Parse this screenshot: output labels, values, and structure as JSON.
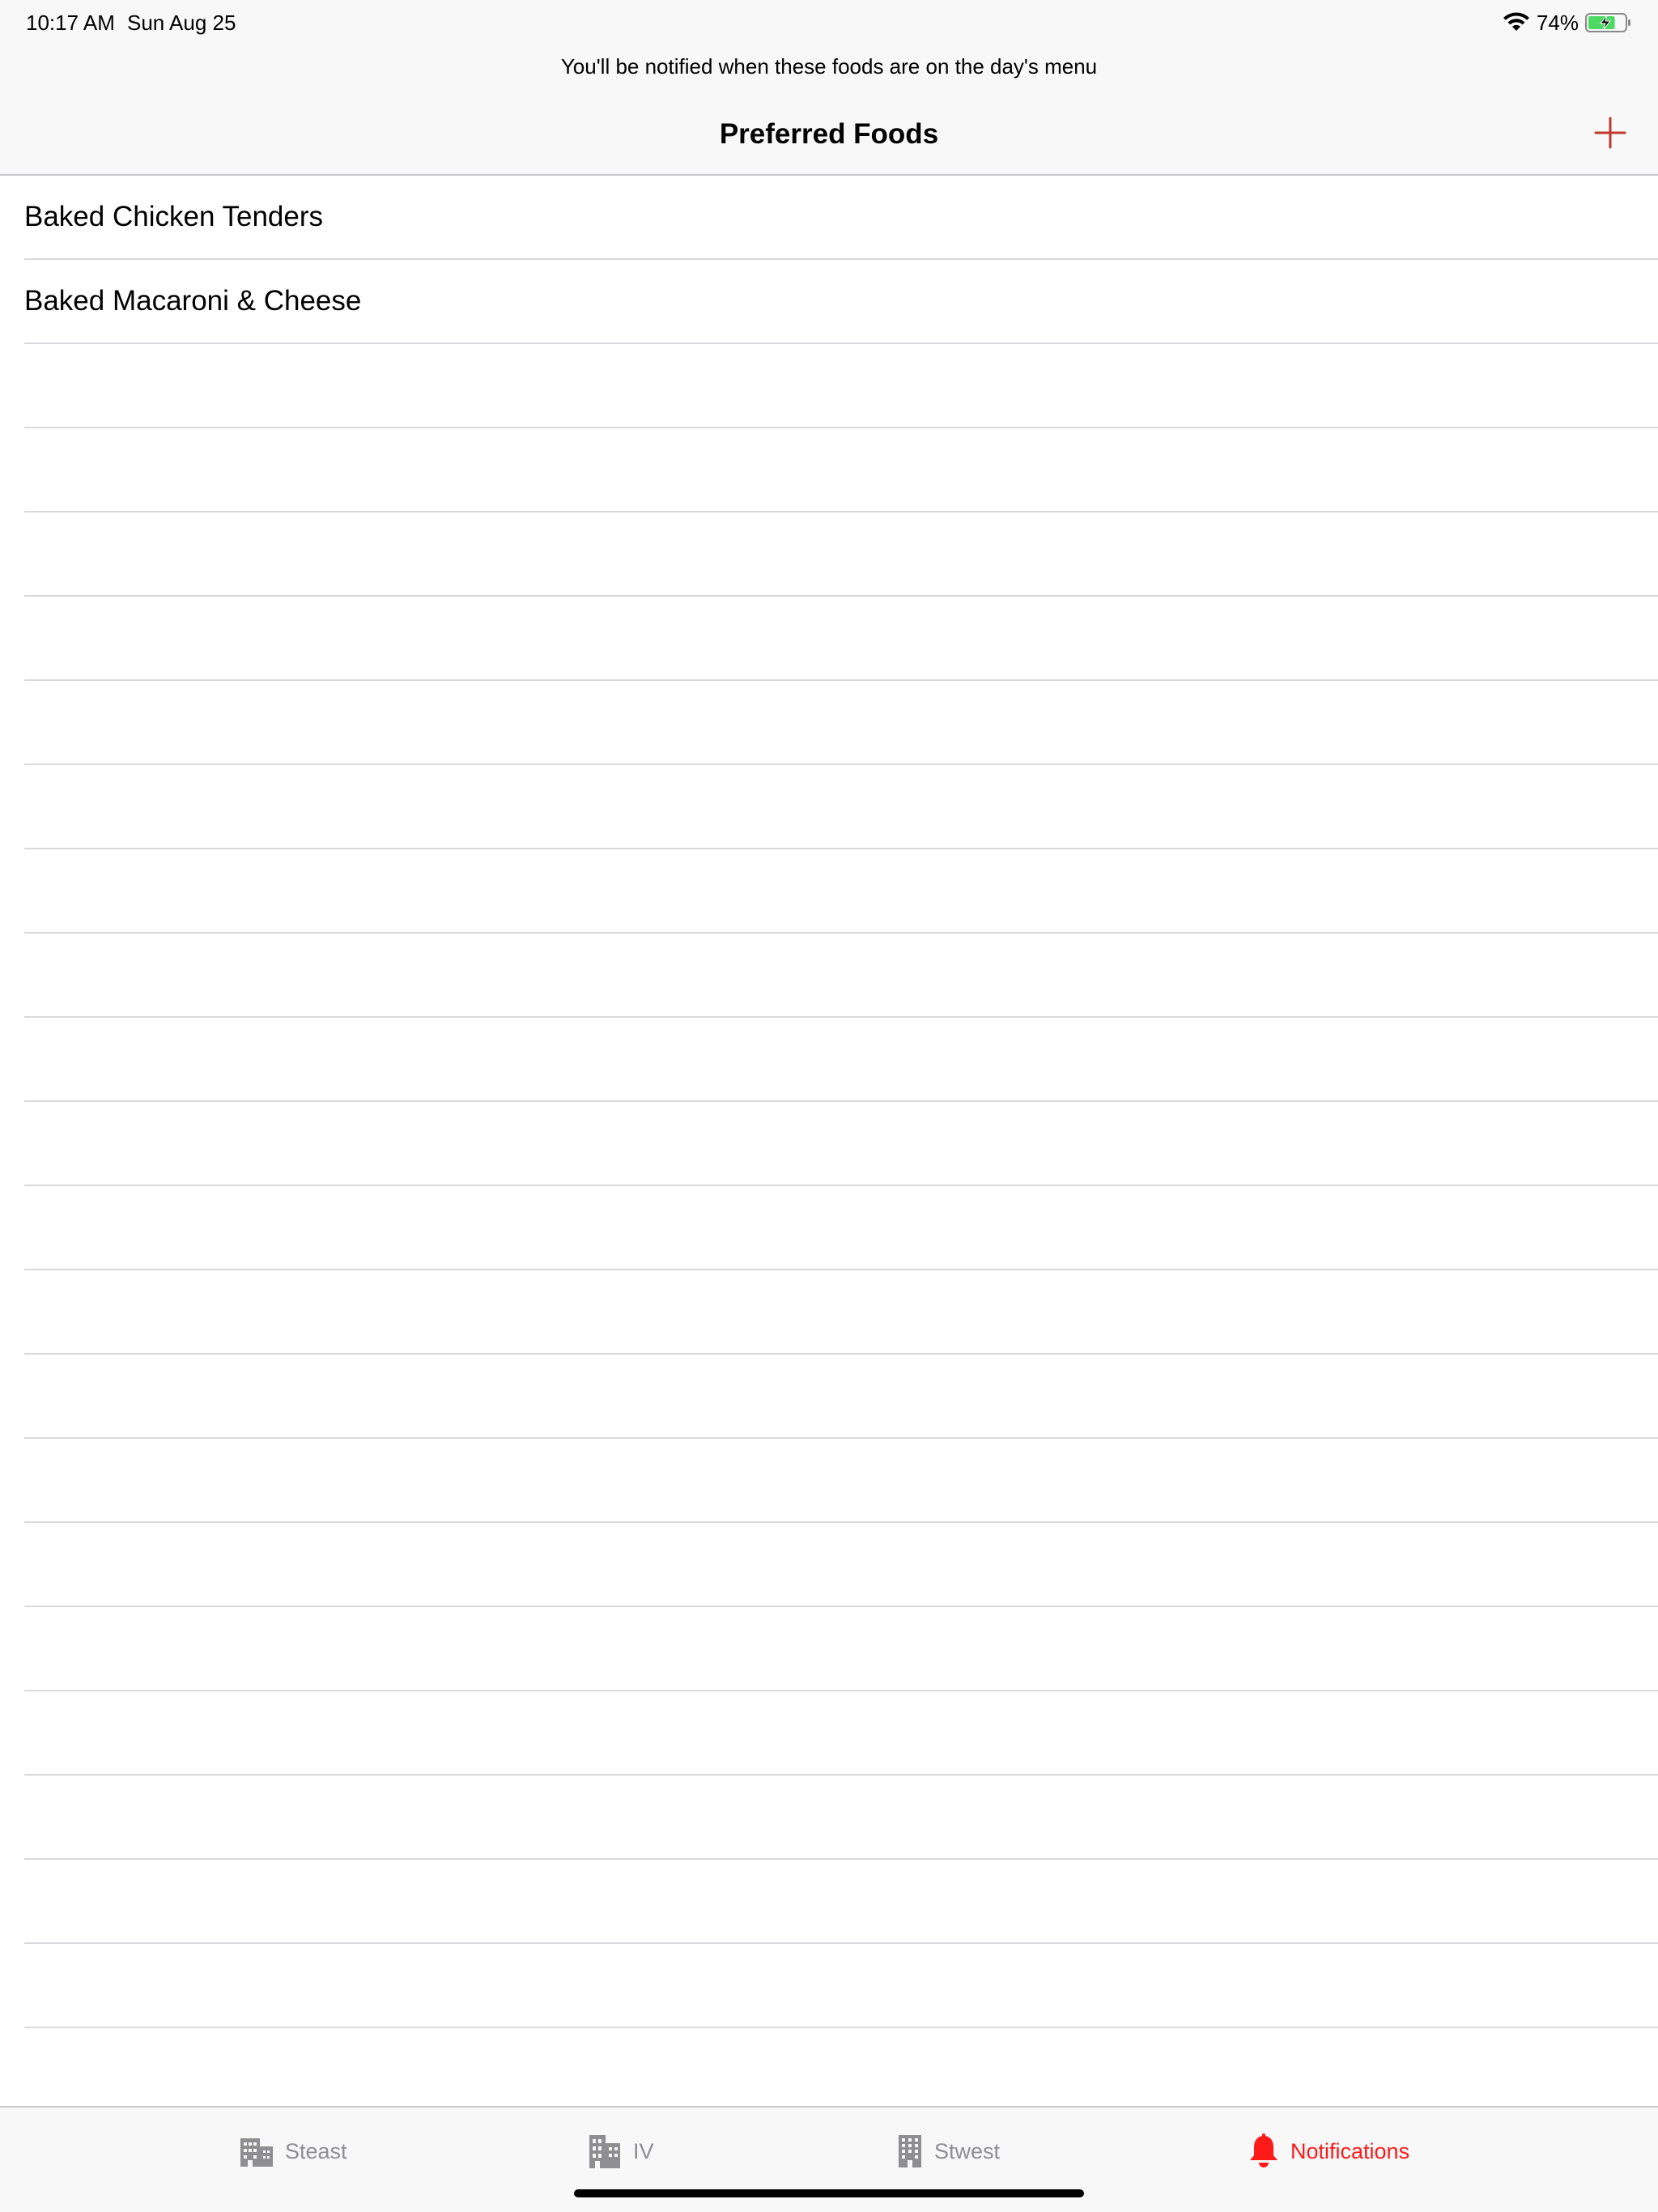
{
  "status_bar": {
    "time": "10:17 AM",
    "date": "Sun Aug 25",
    "battery_percent": "74%",
    "battery_level": 0.74,
    "charging": true,
    "wifi_icon": "wifi-icon",
    "battery_icon": "battery-charging-icon"
  },
  "header": {
    "subtitle": "You'll be notified when these foods are on the day's menu",
    "title": "Preferred Foods",
    "add_icon": "plus-icon"
  },
  "list": {
    "items": [
      {
        "label": "Baked Chicken Tenders"
      },
      {
        "label": "Baked Macaroni & Cheese"
      }
    ],
    "empty_rows": 20
  },
  "tabbar": {
    "tabs": [
      {
        "label": "Steast",
        "icon": "building-icon",
        "selected": false
      },
      {
        "label": "IV",
        "icon": "buildings-icon",
        "selected": false
      },
      {
        "label": "Stwest",
        "icon": "tall-building-icon",
        "selected": false
      },
      {
        "label": "Notifications",
        "icon": "bell-icon",
        "selected": true
      }
    ]
  },
  "colors": {
    "accent": "#ff1a1a",
    "add_button": "#c0392b",
    "inactive_tab": "#8e8e93",
    "battery_fill": "#4cd964",
    "separator": "#d9d9dd",
    "bar_background": "#f8f8f8"
  }
}
